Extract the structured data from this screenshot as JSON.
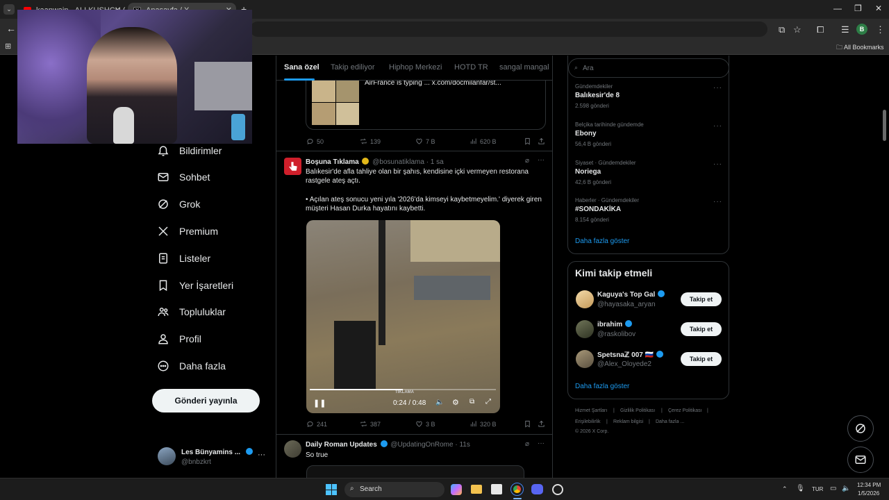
{
  "browser": {
    "tabs": [
      {
        "label": "kaanwain - ALI KUSHCU (C...",
        "active": false
      },
      {
        "label": "Anasayfa / X",
        "active": true
      }
    ],
    "bookmarks_label": "All Bookmarks",
    "profile_initial": "B"
  },
  "feed_tabs": [
    {
      "label": "Sana özel",
      "active": true
    },
    {
      "label": "Takip ediliyor",
      "active": false
    },
    {
      "label": "Hiphop Merkezi",
      "active": false
    },
    {
      "label": "HOTD TR",
      "active": false
    },
    {
      "label": "sangal mangal",
      "active": false
    }
  ],
  "nav": {
    "items": [
      {
        "label": "Bildirimler",
        "icon": "bell-icon"
      },
      {
        "label": "Sohbet",
        "icon": "mail-icon"
      },
      {
        "label": "Grok",
        "icon": "grok-icon"
      },
      {
        "label": "Premium",
        "icon": "x-logo-icon"
      },
      {
        "label": "Listeler",
        "icon": "list-icon"
      },
      {
        "label": "Yer İşaretleri",
        "icon": "bookmark-icon"
      },
      {
        "label": "Topluluklar",
        "icon": "people-icon"
      },
      {
        "label": "Profil",
        "icon": "person-icon"
      },
      {
        "label": "Daha fazla",
        "icon": "more-circle-icon"
      }
    ],
    "post_button": "Gönderi yayınla",
    "account": {
      "name": "Les Bünyamins ...",
      "handle": "@bnbzkrt"
    }
  },
  "tweet_prev": {
    "text": "AirFrance is typing ...  x.com/docmilanfar/st...",
    "replies": "50",
    "reposts": "139",
    "likes": "7 B",
    "views": "620 B"
  },
  "tweet_main": {
    "name": "Boşuna Tıklama",
    "handle": "@bosunatiklama",
    "time": "· 1 sa",
    "text1": "Balıkesir'de afla tahliye olan bir şahıs, kendisine içki vermeyen restorana rastgele ateş açtı.",
    "text2": "• Açılan ateş sonucu yeni yıla '2026'da kimseyi kaybetmeyelim.' diyerek giren müşteri Hasan Durka hayatını kaybetti.",
    "video_time": "0:24 / 0:48",
    "video_progress": 0.5,
    "watermark": "TIKLAMA",
    "replies": "241",
    "reposts": "387",
    "likes": "3 B",
    "views": "320 B"
  },
  "tweet_next": {
    "name": "Daily Roman Updates",
    "handle": "@UpdatingOnRome",
    "time": "· 11s",
    "text": "So true"
  },
  "search_placeholder": "Ara",
  "trends": [
    {
      "meta": "Gündemdekiler",
      "name": "Balıkesir'de 8",
      "count": "2.598 gönderi"
    },
    {
      "meta": "Belçika tarihinde gündemde",
      "name": "Ebony",
      "count": "56,4 B gönderi"
    },
    {
      "meta": "Siyaset · Gündemdekiler",
      "name": "Noriega",
      "count": "42,6 B gönderi"
    },
    {
      "meta": "Haberler · Gündemdekiler",
      "name": "#SONDAKİKA",
      "count": "8.154 gönderi"
    }
  ],
  "show_more": "Daha fazla göster",
  "who_to_follow": {
    "title": "Kimi takip etmeli",
    "follow_label": "Takip et",
    "users": [
      {
        "name": "Kaguya's Top Gal",
        "handle": "@hayasaka_aryan"
      },
      {
        "name": "ibrahim",
        "handle": "@raskolibov"
      },
      {
        "name": "Spetsnaℤ 007 🇷🇺",
        "handle": "@Alex_Oloyede2"
      }
    ]
  },
  "footer": {
    "links": [
      "Hizmet Şartları",
      "Gizlilik Politikası",
      "Çerez Politikası",
      "Erişilebilirlik",
      "Reklam bilgisi",
      "Daha fazla ..."
    ],
    "copyright": "© 2026 X Corp."
  },
  "taskbar": {
    "search_label": "Search",
    "language": "TUR",
    "time": "12:34 PM",
    "date": "1/5/2026"
  },
  "colors": {
    "accent": "#1d9bf0",
    "background": "#000000",
    "muted": "#71767b"
  }
}
